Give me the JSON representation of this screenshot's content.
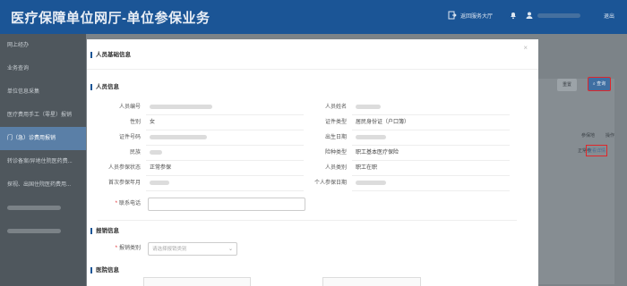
{
  "app": {
    "title": "医疗保障单位网厅-单位参保业务",
    "return_hall": "返回服务大厅",
    "logout": "退出"
  },
  "sidebar": {
    "items": [
      {
        "label": "网上经办",
        "state": "normal"
      },
      {
        "label": "业务查询",
        "state": "normal"
      },
      {
        "label": "单位信息采集",
        "state": "normal"
      },
      {
        "label": "医疗费用手工（零星）报销",
        "state": "normal"
      },
      {
        "label": "门（急）诊费用报销",
        "state": "active"
      },
      {
        "label": "转诊备案/异地住院医药费...",
        "state": "normal"
      },
      {
        "label": "探视、出国住院医药费用...",
        "state": "normal"
      },
      {
        "label": "",
        "state": "blurred"
      },
      {
        "label": "",
        "state": "blurred"
      }
    ]
  },
  "background": {
    "reset_button": "重置",
    "query_button": "查询",
    "col_insured": "参保地",
    "col_operation": "操作",
    "cell_insured": "正常参",
    "cell_view": "查看详情"
  },
  "modal": {
    "close": "×",
    "title": "人员基础信息",
    "section_person": "人员信息",
    "fields": {
      "person_no": "人员编号",
      "person_name": "人员姓名",
      "gender": "性别",
      "gender_value": "女",
      "cert_type": "证件类型",
      "cert_type_value": "居民身份证（户口簿）",
      "cert_no": "证件号码",
      "birth_date": "出生日期",
      "nation": "民族",
      "insurance_type": "险种类型",
      "insurance_type_value": "职工基本医疗保险",
      "insured_status": "人员参保状态",
      "insured_status_value": "正常参保",
      "person_category": "人员类别",
      "person_category_value": "职工在职",
      "first_insured_date": "首次参保年月",
      "personal_insured_date": "个人参保日期",
      "phone": "联系电话"
    },
    "section_reimburse": "报销信息",
    "reimburse_category_label": "报销类别",
    "reimburse_category_placeholder": "请选择报销类别",
    "section_hospital": "医院信息"
  },
  "colors": {
    "topbar": "#1b5596",
    "accent": "#1b5596",
    "highlight": "#e0262a"
  }
}
